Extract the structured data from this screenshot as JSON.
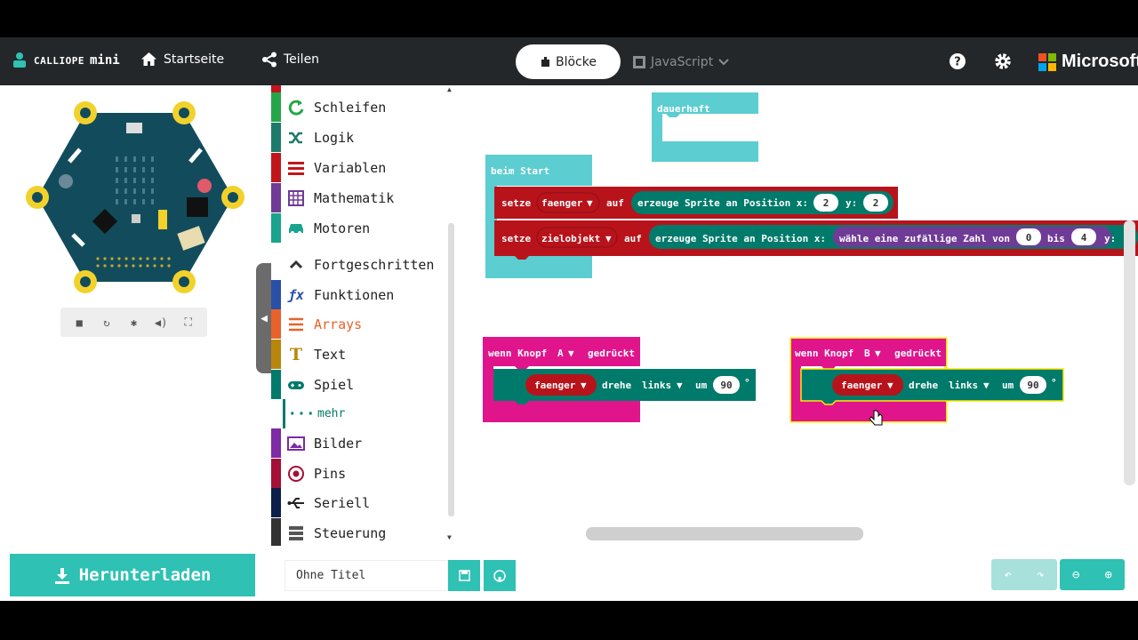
{
  "header": {
    "brand_small": "CALLIOPE",
    "brand_main": "mini",
    "home_label": "Startseite",
    "share_label": "Teilen",
    "tab_blocks": "Blöcke",
    "tab_js": "JavaScript",
    "microsoft": "Microsoft"
  },
  "simulator": {
    "controls": [
      "stop-icon",
      "restart-icon",
      "debug-icon",
      "mute-icon",
      "fullscreen-icon"
    ]
  },
  "toolbox": {
    "categories": [
      {
        "label": "Schleifen",
        "color": "#26a64a",
        "icon": "loop-icon"
      },
      {
        "label": "Logik",
        "color": "#1e7b6b",
        "icon": "shuffle-icon"
      },
      {
        "label": "Variablen",
        "color": "#c2151b",
        "icon": "variables-icon"
      },
      {
        "label": "Mathematik",
        "color": "#6f3b96",
        "icon": "calculator-icon"
      },
      {
        "label": "Motoren",
        "color": "#1aa38d",
        "icon": "car-icon"
      },
      {
        "label": "Fortgeschritten",
        "color": "#6b6b6b",
        "icon": "chevron-up-icon"
      },
      {
        "label": "Funktionen",
        "color": "#2a4fa6",
        "icon": "function-icon"
      },
      {
        "label": "Arrays",
        "color": "#e8622b",
        "icon": "list-icon"
      },
      {
        "label": "Text",
        "color": "#b8860b",
        "icon": "text-icon"
      },
      {
        "label": "Spiel",
        "color": "#007a6a",
        "icon": "gamepad-icon"
      },
      {
        "label": "mehr",
        "color": "#007a6a",
        "icon": "ellipsis-icon"
      },
      {
        "label": "Bilder",
        "color": "#7c2aa6",
        "icon": "image-icon"
      },
      {
        "label": "Pins",
        "color": "#a40f35",
        "icon": "target-icon"
      },
      {
        "label": "Seriell",
        "color": "#0b1f4a",
        "icon": "usb-icon"
      },
      {
        "label": "Steuerung",
        "color": "#333333",
        "icon": "control-icon"
      }
    ]
  },
  "workspace": {
    "forever_label": "dauerhaft",
    "on_start_label": "beim Start",
    "set_label": "setze",
    "var1": "faenger",
    "var2": "zielobjekt",
    "to_label": "auf",
    "create_sprite": "erzeuge Sprite an Position x:",
    "y_label": "y:",
    "x_val1": "2",
    "y_val1": "2",
    "random_label": "wähle eine zufällige Zahl von",
    "rand_from": "0",
    "rand_to_label": "bis",
    "rand_to": "4",
    "y_label2": "y:",
    "button_a_prefix": "wenn Knopf",
    "button_a": "A",
    "pressed": "gedrückt",
    "button_b_prefix": "wenn Knopf",
    "button_b": "B",
    "turn_label": "drehe",
    "direction": "links",
    "by_label": "um",
    "angle_a": "90",
    "angle_b": "90",
    "degree": "°"
  },
  "bottom": {
    "download_label": "Herunterladen",
    "project_name": "Ohne Titel"
  },
  "colors": {
    "teal": "#2ec1b4",
    "event": "#e0158c",
    "variable": "#b8131b",
    "game": "#007a6a",
    "math": "#6f3b96",
    "loops": "#5ccdd0"
  }
}
